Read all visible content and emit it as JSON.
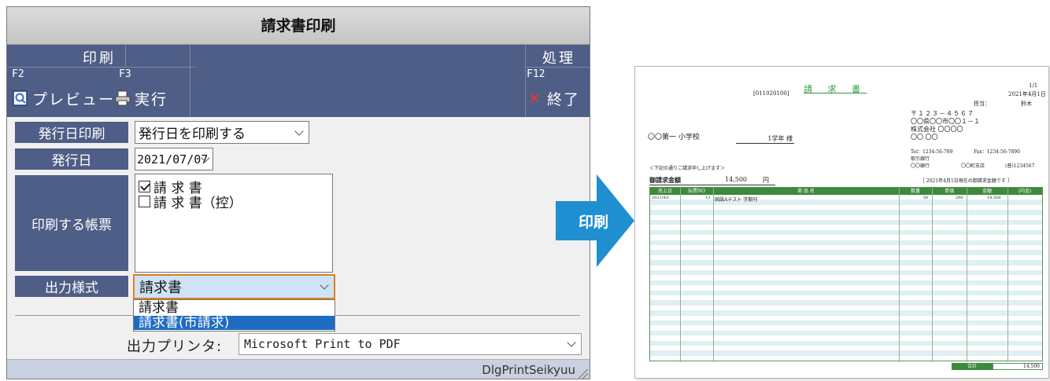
{
  "dialog": {
    "title": "請求書印刷",
    "toolbar": {
      "print_group": "印刷",
      "process_group": "処理",
      "preview": {
        "key": "F2",
        "label": "プレビュー",
        "icon": "preview-icon"
      },
      "execute": {
        "key": "F3",
        "label": "実行",
        "icon": "printer-icon"
      },
      "close": {
        "key": "F12",
        "label": "終了",
        "icon": "close-icon"
      }
    },
    "form": {
      "issue_date_print": {
        "label": "発行日印刷",
        "value": "発行日を印刷する"
      },
      "issue_date": {
        "label": "発行日",
        "value": "2021/07/07"
      },
      "forms": {
        "label": "印刷する帳票",
        "items": [
          {
            "label": "請 求 書",
            "checked": true
          },
          {
            "label": "請 求 書（控）",
            "checked": false
          }
        ]
      },
      "output_style": {
        "label": "出力様式",
        "value": "請求書",
        "options": [
          "請求書",
          "請求書(市請求)"
        ],
        "highlighted": "請求書(市請求)"
      },
      "printer": {
        "label": "出力プリンタ:",
        "value": "Microsoft Print to PDF"
      }
    },
    "status": "DlgPrintSeikyuu"
  },
  "arrow": {
    "label": "印刷",
    "color": "#1f8fd0"
  },
  "invoice": {
    "title": "請 求 書",
    "id": "[011020100]",
    "page": "1/1",
    "date": "2021年4月1日",
    "staff_label": "担当：",
    "staff": "鈴木",
    "postal": "〒１２３－４５６７",
    "sender": [
      "〇〇県〇〇市〇〇１－１",
      "株式会社 〇〇〇〇",
      "〇〇 〇〇"
    ],
    "tel": "Tel：1234-56-789",
    "fax": "Fax：1234-56-7890",
    "bank_label": "取引銀行",
    "bank": "〇〇銀行",
    "branch": "〇〇町支店",
    "account": "(普)1234567",
    "recipient": "〇〇第一 小学校",
    "recipient_class": "1学年 様",
    "notice": "＜下記の通りご請求申し上げます＞",
    "amount_label": "御請求金額",
    "amount": "14,500",
    "amount_unit": "円",
    "as_of": "［ 2021年4月1日現在の御請求金額です ］",
    "columns": [
      "売上日",
      "伝票NO",
      "商 品 名",
      "数量",
      "単価",
      "金額",
      "(内金)"
    ],
    "row": {
      "date": "2021/4/1",
      "no": "13",
      "item": "国語Aテスト 学期刊",
      "qty": "50",
      "price": "290",
      "amount": "14,500"
    },
    "total_label": "合計",
    "total": "14,500",
    "accent": "#3c8a3c"
  }
}
